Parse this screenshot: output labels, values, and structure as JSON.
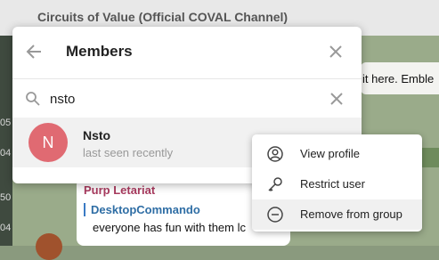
{
  "background": {
    "chat_title": "Circuits of Value (Official COVAL Channel)",
    "top_message_text": "it here.  Emble",
    "timestamps": [
      "05",
      "04",
      "50",
      "04"
    ],
    "message": {
      "author": "Purp Letariat",
      "reply_author": "DesktopCommando",
      "text": "everyone has fun with them lc"
    }
  },
  "dialog": {
    "title": "Members",
    "search": {
      "value": "nsto"
    },
    "member": {
      "initial": "N",
      "name": "Nsto",
      "status": "last seen recently",
      "avatar_color": "#e06a72"
    }
  },
  "context_menu": {
    "items": [
      {
        "label": "View profile",
        "icon": "person-circle-icon"
      },
      {
        "label": "Restrict user",
        "icon": "key-icon"
      },
      {
        "label": "Remove from group",
        "icon": "minus-circle-icon"
      }
    ]
  }
}
